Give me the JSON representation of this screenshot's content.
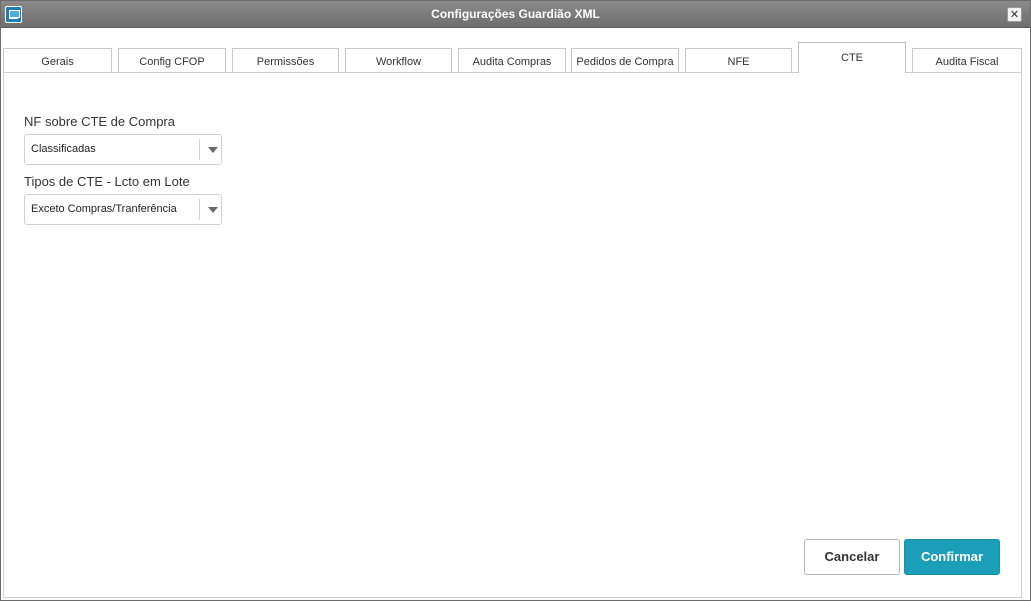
{
  "window": {
    "title": "Configurações Guardião XML",
    "icon": "app-window-icon",
    "close_glyph": "✕"
  },
  "tabs": [
    {
      "label": "Gerais",
      "active": false
    },
    {
      "label": "Config CFOP",
      "active": false
    },
    {
      "label": "Permissões",
      "active": false
    },
    {
      "label": "Workflow",
      "active": false
    },
    {
      "label": "Audita Compras",
      "active": false
    },
    {
      "label": "Pedidos de Compra",
      "active": false
    },
    {
      "label": "NFE",
      "active": false
    },
    {
      "label": "CTE",
      "active": true
    },
    {
      "label": "Audita Fiscal",
      "active": false
    }
  ],
  "form": {
    "nf_cte": {
      "label": "NF sobre CTE de Compra",
      "value": "Classificadas"
    },
    "tipos_cte": {
      "label": "Tipos de CTE - Lcto em Lote",
      "value": "Exceto Compras/Tranferência"
    }
  },
  "actions": {
    "cancel_label": "Cancelar",
    "confirm_label": "Confirmar"
  },
  "colors": {
    "titlebar": "#7a7a7a",
    "accent": "#1b9fb8"
  }
}
